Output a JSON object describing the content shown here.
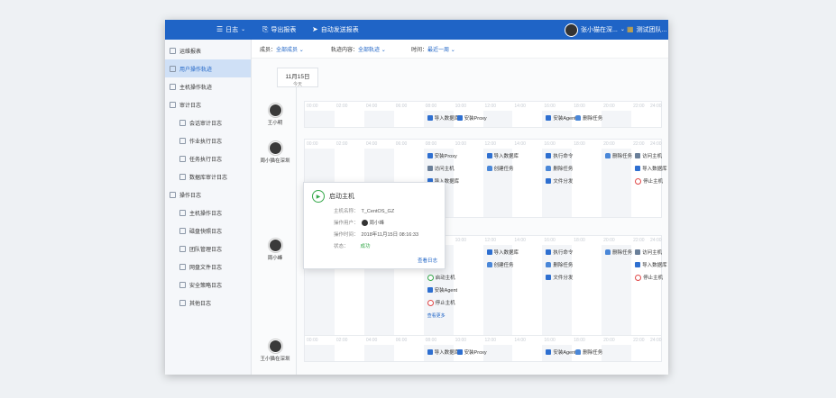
{
  "topbar": {
    "menu_icon": "menu-icon",
    "title": "日志",
    "export": "导出报表",
    "auto_send": "自动发送报表",
    "user": "张小猫在深...",
    "team": "测试团队..."
  },
  "sidebar": {
    "items": [
      {
        "label": "运维报表",
        "type": "top"
      },
      {
        "label": "用户操作轨迹",
        "type": "top",
        "active": true
      },
      {
        "label": "主机操作轨迹",
        "type": "top"
      },
      {
        "label": "审计日志",
        "type": "top"
      },
      {
        "label": "会话审计日志",
        "type": "sub"
      },
      {
        "label": "作业执行日志",
        "type": "sub"
      },
      {
        "label": "任务执行日志",
        "type": "sub"
      },
      {
        "label": "数据库审计日志",
        "type": "sub"
      },
      {
        "label": "操作日志",
        "type": "top"
      },
      {
        "label": "主机操作日志",
        "type": "sub"
      },
      {
        "label": "磁盘快照日志",
        "type": "sub"
      },
      {
        "label": "团队管理日志",
        "type": "sub"
      },
      {
        "label": "网盘文件日志",
        "type": "sub"
      },
      {
        "label": "安全策略日志",
        "type": "sub"
      },
      {
        "label": "其他日志",
        "type": "sub"
      }
    ]
  },
  "filters": {
    "member_label": "成员：",
    "member_value": "全部成员",
    "content_label": "轨迹内容：",
    "content_value": "全部轨迹",
    "time_label": "时间：",
    "time_value": "最近一周"
  },
  "date": {
    "day": "11月15日",
    "sub": "今天"
  },
  "hours": [
    "00:00",
    "02:00",
    "04:00",
    "06:00",
    "08:00",
    "10:00",
    "12:00",
    "14:00",
    "16:00",
    "18:00",
    "20:00",
    "22:00",
    "24:00"
  ],
  "users": [
    "王小明",
    "周小猫在深圳",
    "周小峰",
    "王小猫在深圳"
  ],
  "events": {
    "import_db": "导入数据库",
    "install_proxy": "安装Proxy",
    "install_agent": "安装Agent",
    "delete_task": "删除任务",
    "visit_host": "访问主机",
    "exec_cmd": "执行命令",
    "create_task": "创建任务",
    "file_dist": "文件分发",
    "stop_host": "停止主机",
    "start_host": "启动主机",
    "view_more": "查看更多"
  },
  "popup": {
    "title": "启动主机",
    "host_label": "主机名称：",
    "host_value": "T_CentOS_GZ",
    "user_label": "操作用户：",
    "user_value": "周小峰",
    "time_label": "操作时间：",
    "time_value": "2018年11月15日 08:16:33",
    "status_label": "状态：",
    "status_value": "成功",
    "view_log": "查看日志"
  }
}
